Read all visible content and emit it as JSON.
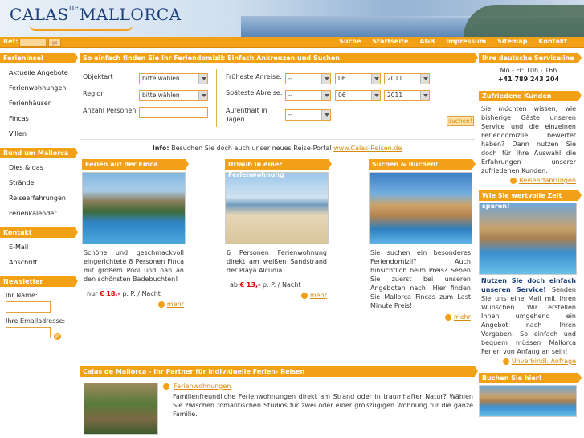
{
  "header": {
    "logo_main": "CALAS",
    "logo_de": "DE",
    "logo_tail": "MALLORCA"
  },
  "navbar": {
    "ref_label": "Ref:",
    "ref_go": "go",
    "links": [
      "Suche",
      "Startseite",
      "AGB",
      "Impressum",
      "Sitemap",
      "Kontakt"
    ]
  },
  "sidebar": {
    "sections": [
      {
        "title": "Ferieninsel Mallorca",
        "items": [
          "Aktuelle Angebote",
          "Ferienwohnungen",
          "Ferienhäuser",
          "Fincas",
          "Villen"
        ]
      },
      {
        "title": "Rund um Mallorca",
        "items": [
          "Dies & das",
          "Strände",
          "Reiseerfahrungen",
          "Ferienkalender"
        ]
      },
      {
        "title": "Kontakt",
        "items": [
          "E-Mail",
          "Anschrift"
        ]
      }
    ],
    "newsletter": {
      "title": "Newsletter",
      "name_label": "Ihr Name:",
      "email_label": "Ihre Emailadresse:",
      "go": "go"
    }
  },
  "search": {
    "title": "So einfach finden Sie Ihr Feriendomizil: Einfach Ankreuzen und Suchen",
    "objekttyp_label": "Objektart",
    "objekttyp_value": "bitte wählen",
    "region_label": "Region",
    "region_value": "bitte wählen",
    "personen_label": "Anzahl Personen",
    "anreise_label": "Früheste Anreise:",
    "abreise_label": "Späteste Abreise:",
    "aufenthalt_label": "Aufenthalt in Tagen",
    "day_value": "--",
    "month_value": "06",
    "year_value": "2011",
    "days_value": "--",
    "button": "suchen!"
  },
  "info": {
    "label": "Info:",
    "text": "Besuchen Sie doch auch unser neues Reise-Portal",
    "link": "www.Calas-Reisen.de"
  },
  "teasers": [
    {
      "title": "Ferien auf der Finca",
      "text": "Schöne und geschmackvoll eingerichtete 8 Personen Finca mit großem Pool und nah an den schönsten Badebuchten!",
      "price_prefix": "nur",
      "price": "€ 18,-",
      "price_suffix": "p. P. / Nacht",
      "more": "mehr"
    },
    {
      "title": "Urlaub in einer Ferienwohnung",
      "text": "6 Personen Ferienwohnung direkt am weißen Sandstrand der Playa Alcudia",
      "price_prefix": "ab",
      "price": "€ 13,-",
      "price_suffix": "p. P. / Nacht",
      "more": "mehr"
    },
    {
      "title": "Suchen & Buchen!",
      "text": "Sie suchen ein besonderes Feriendomizil? Auch hinsichtlich beim Preis? Sehen Sie zuerst bei unseren Angeboten nach! Hier finden Sie Mallorca Fincas zum Last Minute Preis!",
      "more": "mehr"
    }
  ],
  "partner": {
    "title": "Calas de Mallorca - Ihr Partner für individuelle Ferien- Reisen",
    "link": "Ferienwohnungen",
    "text": "Familienfreundliche Ferienwohnungen direkt am Strand oder in traumhafter Natur? Wählen Sie zwischen romantischen Studios für zwei oder einer großzügigen Wohnung für die ganze Familie."
  },
  "right": {
    "service": {
      "title": "Ihre deutsche Serviceline",
      "hours": "Mo - Fr: 10h - 16h",
      "phone": "+41 789 243 204"
    },
    "kunden": {
      "title": "Zufriedene Kunden berichten",
      "text": "Sie möchten wissen, wie bisherige Gäste unseren Service und die einzelnen Feriendomizile bewertet haben? Dann nutzen Sie doch für Ihre Auswahl die Erfahrungen unserer zufriedenen Kunden.",
      "link": "Reiseerfahrungen"
    },
    "zeit": {
      "title": "Wie Sie wertvolle Zeit sparen!",
      "strong": "Nutzen Sie doch einfach unseren Service!",
      "text": "Senden Sie uns eine Mail mit Ihren Wünschen. Wir erstellen Ihnen umgehend ein Angebot nach Ihren Vorgaben. So einfach und bequem müssen Mallorca Ferien von Anfang an sein!",
      "link": "Unverbindl. Anfrage"
    },
    "buchen": {
      "title": "Buchen Sie hier!"
    }
  },
  "colors": {
    "accent": "#f2a016",
    "brand": "#1c3f7a",
    "price": "#dd0000"
  }
}
